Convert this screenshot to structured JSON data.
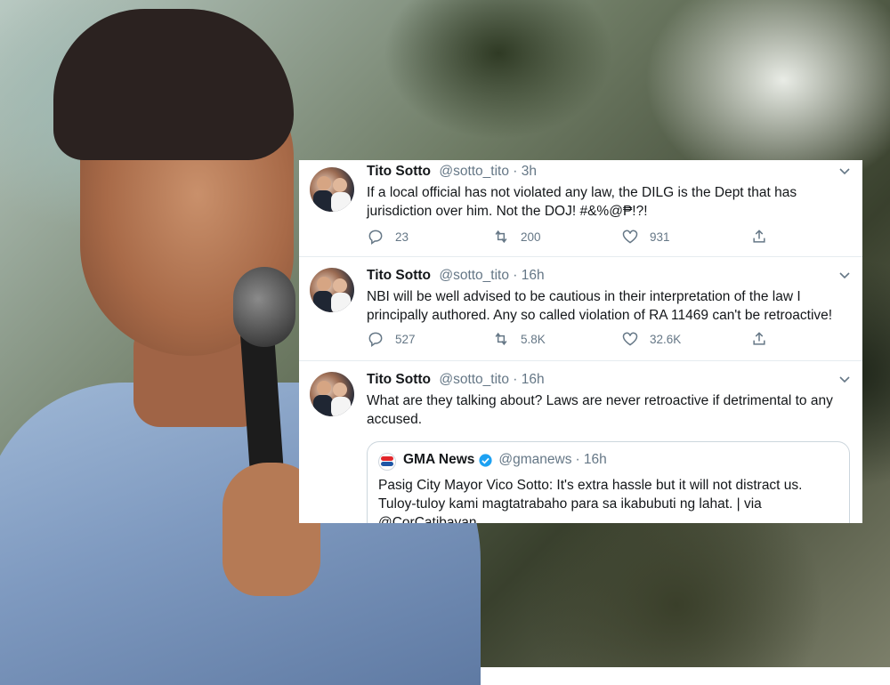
{
  "tweets": [
    {
      "name": "Tito Sotto",
      "handle": "@sotto_tito",
      "time": "· 3h",
      "text": "If a local official has not violated any law, the DILG is the Dept that has jurisdiction over him. Not the DOJ! #&%@₱!?!",
      "replies": "23",
      "retweets": "200",
      "likes": "931"
    },
    {
      "name": "Tito Sotto",
      "handle": "@sotto_tito",
      "time": "· 16h",
      "text": "NBI will be well advised to be cautious in their interpretation of the law I principally authored. Any so called violation of RA 11469 can't be retroactive!",
      "replies": "527",
      "retweets": "5.8K",
      "likes": "32.6K"
    },
    {
      "name": "Tito Sotto",
      "handle": "@sotto_tito",
      "time": "· 16h",
      "text": "What are they talking about? Laws are never retroactive if detrimental to any accused.",
      "quote": {
        "name": "GMA News",
        "handle": "@gmanews",
        "time": "· 16h",
        "text": "Pasig City Mayor Vico Sotto: It's extra hassle but it will not distract us. Tuloy-tuloy kami magtatrabaho para sa ikabubuti ng lahat. | via @CorCatibayan"
      }
    }
  ],
  "colors": {
    "text": "#14171a",
    "muted": "#657786",
    "verified": "#1da1f2",
    "border": "#e6ecf0"
  },
  "icons": [
    "reply-icon",
    "retweet-icon",
    "like-icon",
    "share-icon",
    "chevron-down-icon",
    "verified-icon"
  ]
}
